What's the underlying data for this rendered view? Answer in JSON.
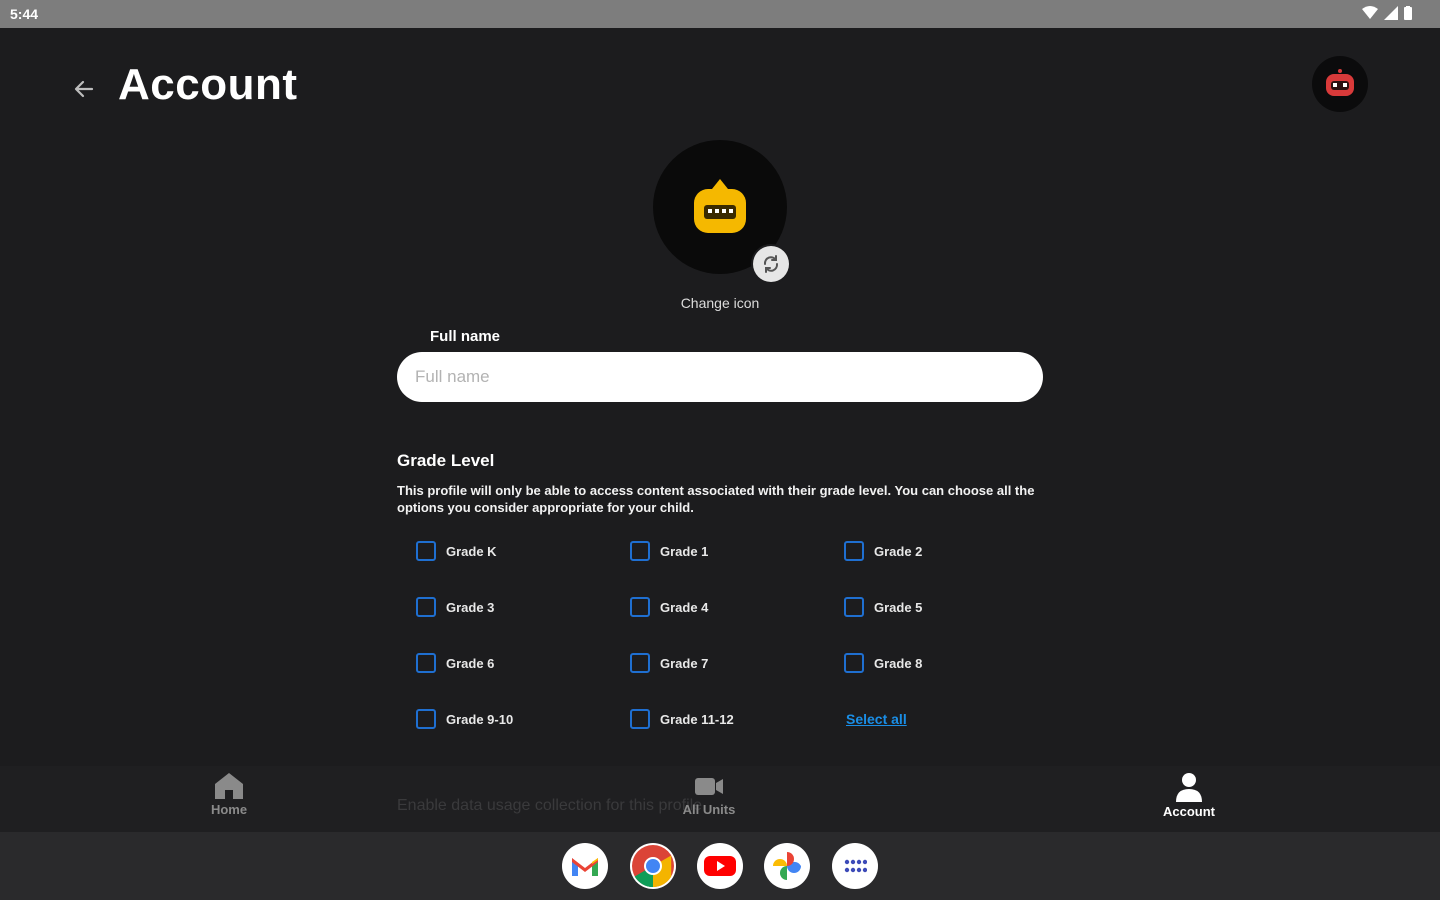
{
  "status_bar": {
    "time": "5:44"
  },
  "header": {
    "title": "Account"
  },
  "avatar": {
    "change_icon_label": "Change icon"
  },
  "full_name": {
    "label": "Full name",
    "placeholder": "Full name",
    "value": ""
  },
  "grade_level": {
    "title": "Grade Level",
    "description": "This profile will only be able to access  content associated with their grade level. You can choose all the options you consider appropriate for your child.",
    "grades": [
      {
        "label": "Grade K",
        "checked": false
      },
      {
        "label": "Grade 1",
        "checked": false
      },
      {
        "label": "Grade 2",
        "checked": false
      },
      {
        "label": "Grade 3",
        "checked": false
      },
      {
        "label": "Grade 4",
        "checked": false
      },
      {
        "label": "Grade 5",
        "checked": false
      },
      {
        "label": "Grade 6",
        "checked": false
      },
      {
        "label": "Grade 7",
        "checked": false
      },
      {
        "label": "Grade 8",
        "checked": false
      },
      {
        "label": "Grade 9-10",
        "checked": false
      },
      {
        "label": "Grade 11-12",
        "checked": false
      }
    ],
    "select_all_label": "Select all"
  },
  "faded_text": "Enable data usage collection for this profile",
  "bottom_nav": [
    {
      "label": "Home",
      "icon": "home-icon",
      "active": false
    },
    {
      "label": "All Units",
      "icon": "video-camera-icon",
      "active": false
    },
    {
      "label": "Account",
      "icon": "person-icon",
      "active": true
    }
  ],
  "dock_apps": [
    "gmail-icon",
    "chrome-icon",
    "youtube-icon",
    "photos-icon",
    "app-drawer-icon"
  ],
  "colors": {
    "background": "#1c1c1e",
    "accent": "#1f6fd1",
    "link": "#1a8ee6",
    "avatar_yellow": "#f5b800",
    "badge_red": "#d93a3a"
  }
}
